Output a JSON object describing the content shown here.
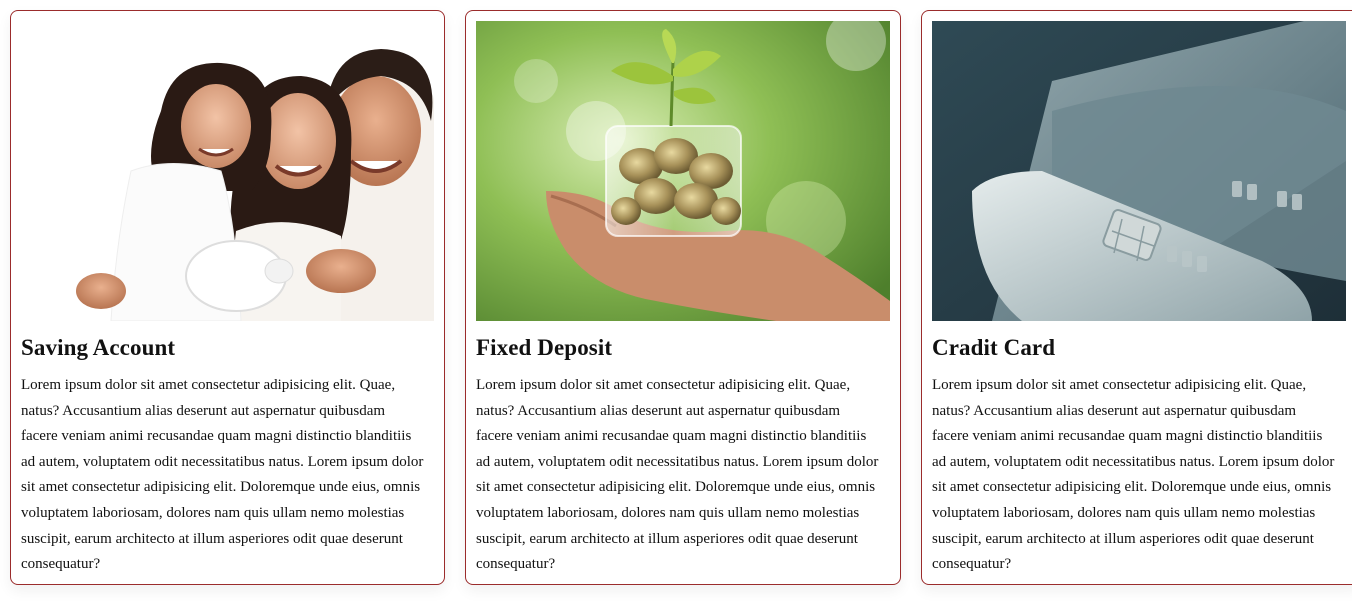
{
  "cards": [
    {
      "title": "Saving Account",
      "image_desc": "family-photo",
      "body": "Lorem ipsum dolor sit amet consectetur adipisicing elit. Quae, natus? Accusantium alias deserunt aut aspernatur quibusdam facere veniam animi recusandae quam magni distinctio blanditiis ad autem, voluptatem odit necessitatibus natus. Lorem ipsum dolor sit amet consectetur adipisicing elit. Doloremque unde eius, omnis voluptatem laboriosam, dolores nam quis ullam nemo molestias suscipit, earum architecto at illum asperiores odit quae deserunt consequatur?"
    },
    {
      "title": "Fixed Deposit",
      "image_desc": "coins-jar-photo",
      "body": "Lorem ipsum dolor sit amet consectetur adipisicing elit. Quae, natus? Accusantium alias deserunt aut aspernatur quibusdam facere veniam animi recusandae quam magni distinctio blanditiis ad autem, voluptatem odit necessitatibus natus. Lorem ipsum dolor sit amet consectetur adipisicing elit. Doloremque unde eius, omnis voluptatem laboriosam, dolores nam quis ullam nemo molestias suscipit, earum architecto at illum asperiores odit quae deserunt consequatur?"
    },
    {
      "title": "Cradit Card",
      "image_desc": "credit-cards-photo",
      "body": "Lorem ipsum dolor sit amet consectetur adipisicing elit. Quae, natus? Accusantium alias deserunt aut aspernatur quibusdam facere veniam animi recusandae quam magni distinctio blanditiis ad autem, voluptatem odit necessitatibus natus. Lorem ipsum dolor sit amet consectetur adipisicing elit. Doloremque unde eius, omnis voluptatem laboriosam, dolores nam quis ullam nemo molestias suscipit, earum architecto at illum asperiores odit quae deserunt consequatur?"
    }
  ],
  "colors": {
    "card_border": "#9b2c2c",
    "text": "#111111"
  }
}
